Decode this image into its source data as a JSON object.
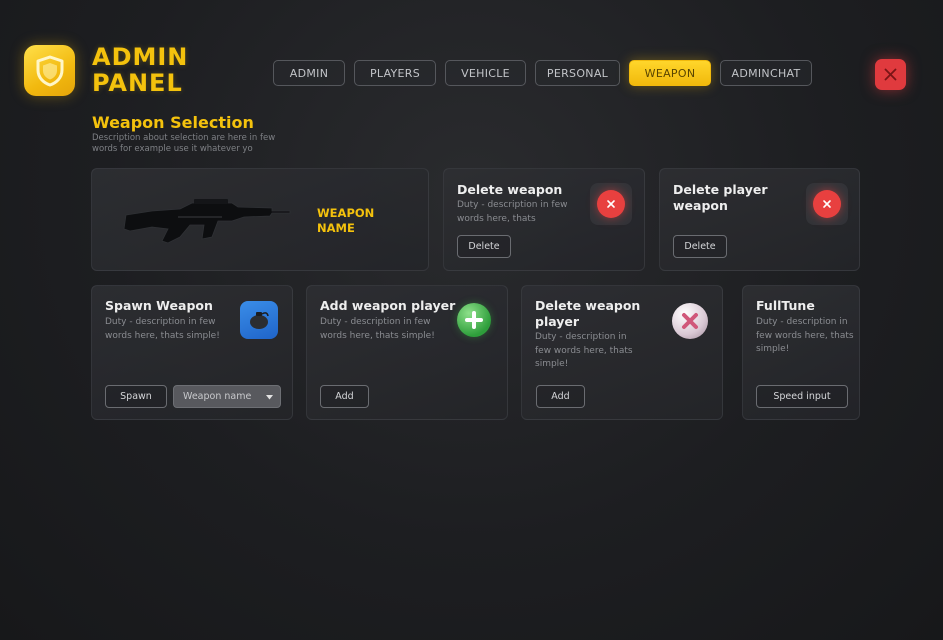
{
  "header": {
    "logo_icon": "shield-icon",
    "title_line1": "ADMIN",
    "title_line2": "PANEL",
    "accent_color": "#f4c20d",
    "close_icon": "close-icon"
  },
  "tabs": [
    {
      "label": "ADMIN",
      "active": false
    },
    {
      "label": "PLAYERS",
      "active": false
    },
    {
      "label": "VEHICLE",
      "active": false
    },
    {
      "label": "PERSONAL",
      "active": false
    },
    {
      "label": "WEAPON",
      "active": true
    },
    {
      "label": "ADMINCHAT",
      "active": false
    }
  ],
  "section": {
    "title": "Weapon Selection",
    "description": "Description about selection are here in few words for example use it whatever yo"
  },
  "weapon_card": {
    "image_icon": "rifle-icon",
    "name": "WEAPON NAME"
  },
  "delete_weapon": {
    "title": "Delete weapon",
    "description": "Duty - description in few words here, thats",
    "button": "Delete",
    "icon": "close-circle-icon"
  },
  "delete_player_weapon": {
    "title": "Delete player weapon",
    "button": "Delete",
    "icon": "close-circle-icon"
  },
  "spawn_weapon": {
    "title": "Spawn Weapon",
    "description": "Duty - description in few words here, thats simple!",
    "button": "Spawn",
    "select_value": "Weapon name",
    "icon": "grenade-icon"
  },
  "add_weapon_player": {
    "title": "Add weapon player",
    "description": "Duty - description in few words here, thats simple!",
    "button": "Add",
    "icon": "plus-circle-icon"
  },
  "delete_weapon_player": {
    "title": "Delete weapon player",
    "description": "Duty - description in few words here, thats simple!",
    "button": "Add",
    "icon": "remove-ball-icon"
  },
  "fulltune": {
    "title": "FullTune",
    "description": "Duty - description in few words here, thats simple!",
    "button": "Speed input"
  }
}
